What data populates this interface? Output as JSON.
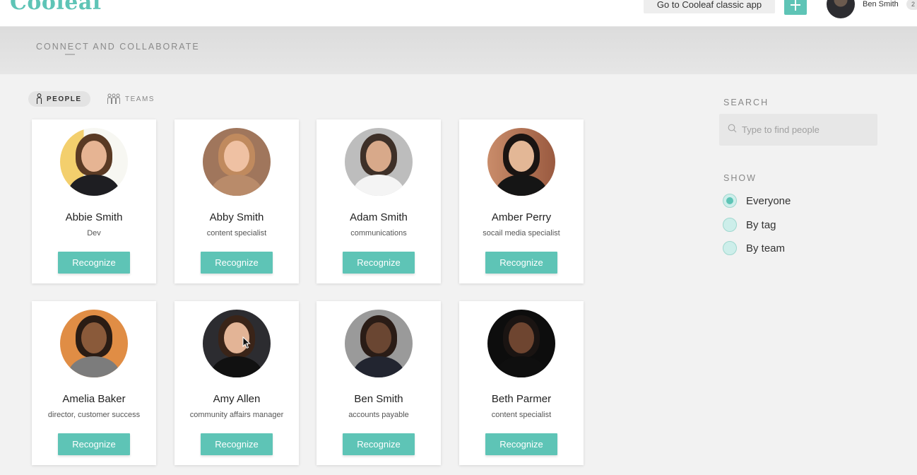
{
  "header": {
    "logo_text": "Cooleaf",
    "classic_app_label": "Go to Cooleaf classic app",
    "user_name": "Ben Smith",
    "user_pill_text": "2"
  },
  "banner": {
    "subtitle": "CONNECT AND COLLABORATE"
  },
  "tabs": {
    "people": "PEOPLE",
    "teams": "TEAMS"
  },
  "people": [
    {
      "name": "Abbie Smith",
      "role": "Dev",
      "button": "Recognize"
    },
    {
      "name": "Abby Smith",
      "role": "content specialist",
      "button": "Recognize"
    },
    {
      "name": "Adam Smith",
      "role": "communications",
      "button": "Recognize"
    },
    {
      "name": "Amber Perry",
      "role": "socail media specialist",
      "button": "Recognize"
    },
    {
      "name": "Amelia Baker",
      "role": "director, customer success",
      "button": "Recognize"
    },
    {
      "name": "Amy Allen",
      "role": "community affairs manager",
      "button": "Recognize"
    },
    {
      "name": "Ben Smith",
      "role": "accounts payable",
      "button": "Recognize"
    },
    {
      "name": "Beth Parmer",
      "role": "content specialist",
      "button": "Recognize"
    }
  ],
  "sidebar": {
    "search_label": "SEARCH",
    "search_placeholder": "Type to find people",
    "show_label": "SHOW",
    "options": [
      {
        "label": "Everyone",
        "selected": true
      },
      {
        "label": "By tag",
        "selected": false
      },
      {
        "label": "By team",
        "selected": false
      }
    ]
  },
  "colors": {
    "accent": "#5ec4b6"
  }
}
